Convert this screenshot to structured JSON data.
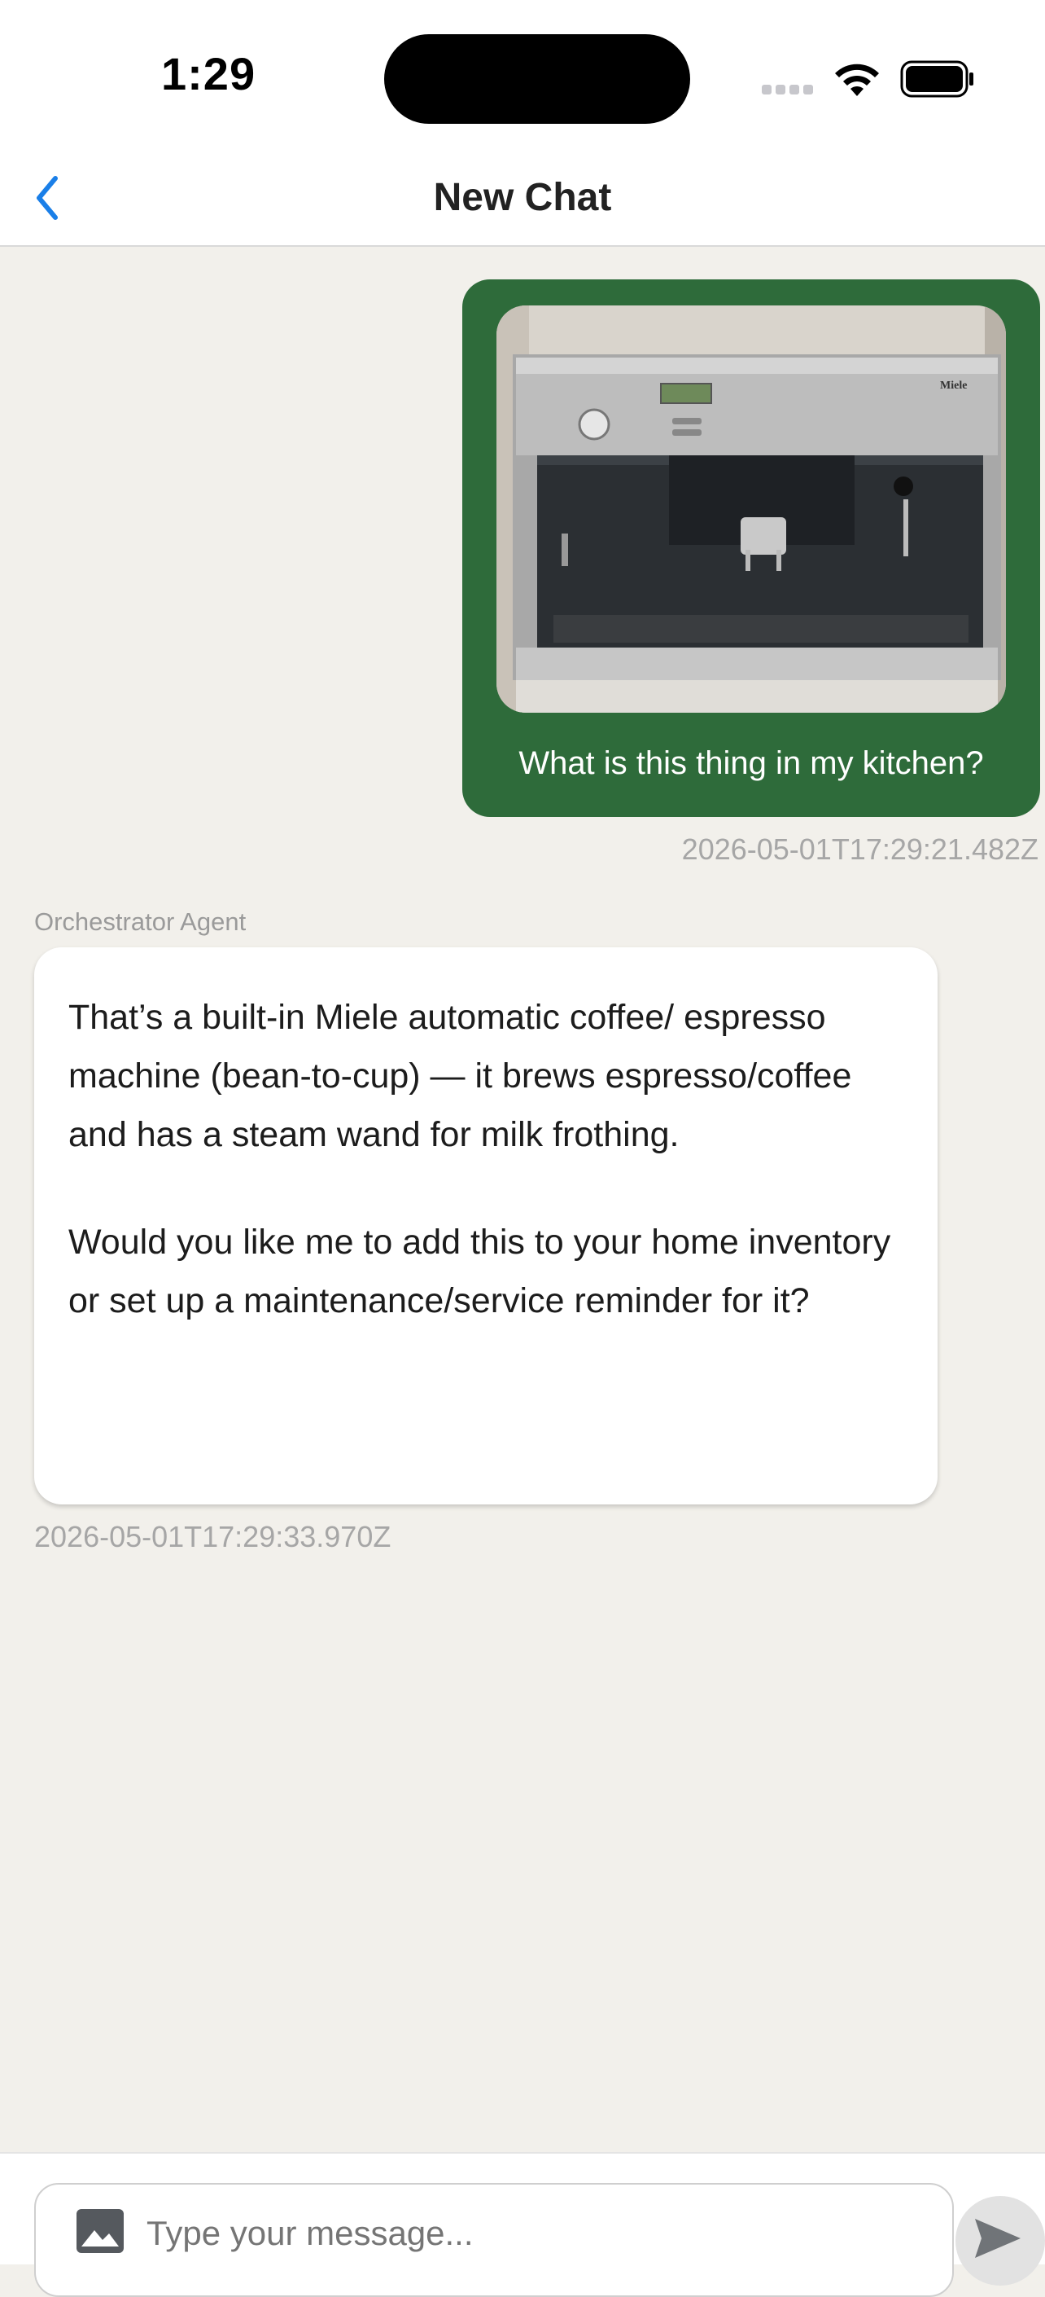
{
  "status_bar": {
    "time": "1:29"
  },
  "nav": {
    "title": "New Chat",
    "back_icon": "chevron-left-icon"
  },
  "messages": [
    {
      "sender": "user",
      "image_description_icon": "photo",
      "text": "What is this thing in my kitchen?",
      "timestamp": "2026-05-01T17:29:21.482Z"
    },
    {
      "sender": "agent",
      "agent_name": "Orchestrator Agent",
      "paragraphs": [
        "That’s a built-in Miele automatic coffee/ espresso machine (bean-to-cup) — it brews espresso/coffee and has a steam wand for milk frothing.",
        "Would you like me to add this to your home inventory or set up a maintenance/service reminder for it?"
      ],
      "timestamp": "2026-05-01T17:29:33.970Z"
    }
  ],
  "photo_text": {
    "brand": "Miele"
  },
  "composer": {
    "placeholder": "Type your message...",
    "attach_icon": "image-icon",
    "send_icon": "send-icon"
  },
  "colors": {
    "user_bubble": "#2e6b3a",
    "background": "#f2f0eb",
    "accent": "#1a7fe8"
  }
}
